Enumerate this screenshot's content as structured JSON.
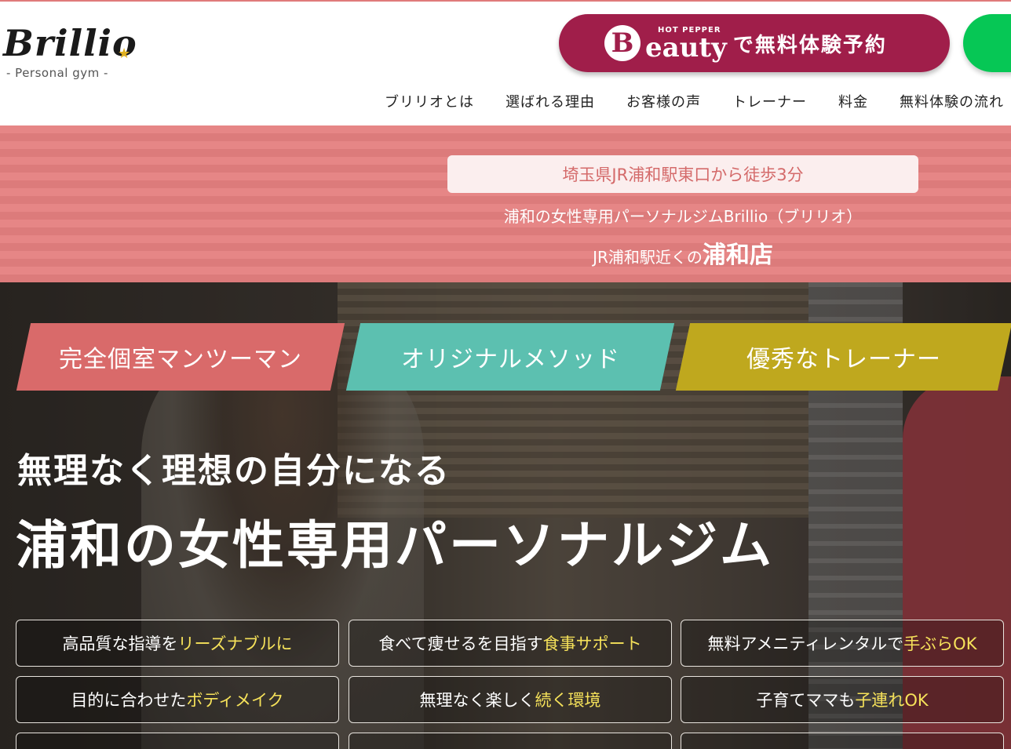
{
  "header": {
    "logo_word": "Brillio",
    "logo_sub": "- Personal gym -",
    "hotpepper_small": "HOT PEPPER",
    "hotpepper_brand": "eauty",
    "hotpepper_b": "B",
    "hotpepper_cta": "で無料体験予約",
    "nav": [
      "ブリリオとは",
      "選ばれる理由",
      "お客様の声",
      "トレーナー",
      "料金",
      "無料体験の流れ"
    ]
  },
  "location": {
    "pill": "埼玉県JR浦和駅東口から徒歩3分",
    "line1": "浦和の女性専用パーソナルジムBrillio（ブリリオ）",
    "line2_prefix": "JR浦和駅近くの",
    "line2_strong": "浦和店"
  },
  "hero": {
    "tags": [
      "完全個室マンツーマン",
      "オリジナルメソッド",
      "優秀なトレーナー"
    ],
    "subtitle": "無理なく理想の自分になる",
    "title": "浦和の女性専用パーソナルジム",
    "features": [
      {
        "text": "高品質な指導を",
        "hl": "リーズナブルに"
      },
      {
        "text": "食べて痩せるを目指す",
        "hl": "食事サポート"
      },
      {
        "text": "無料アメニティレンタルで",
        "hl": "手ぶらOK"
      },
      {
        "text": "目的に合わせた",
        "hl": "ボディメイク"
      },
      {
        "text": "無理なく楽しく",
        "hl": "続く環境"
      },
      {
        "text": "子育てママも",
        "hl": "子連れOK"
      }
    ]
  },
  "colors": {
    "brand_pink": "#e58080",
    "hotpepper": "#a01e4a",
    "line_green": "#06c755",
    "tag_teal": "#5cc0b0",
    "tag_olive": "#bfa81e",
    "highlight": "#f6e25a"
  }
}
